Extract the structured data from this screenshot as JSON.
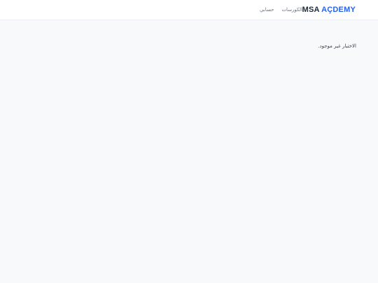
{
  "header": {
    "logo_part1": "MSA",
    "logo_part2": "AÇDEMY",
    "nav": {
      "courses": "الكورسات",
      "account": "حسابي"
    }
  },
  "main": {
    "message": "الاختبار غير موجود."
  }
}
